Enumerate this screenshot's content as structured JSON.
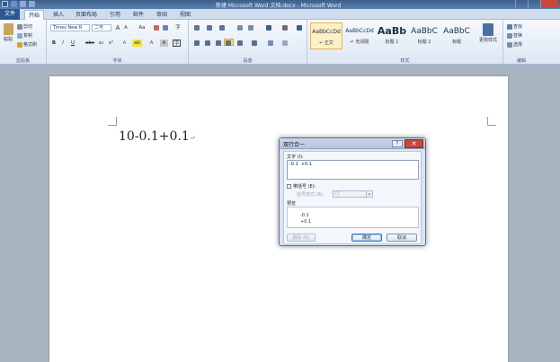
{
  "window": {
    "title": "新建 Microsoft Word 文档.docx - Microsoft Word"
  },
  "tabs": [
    {
      "label": "文件"
    },
    {
      "label": "开始"
    },
    {
      "label": "插入"
    },
    {
      "label": "页面布局"
    },
    {
      "label": "引用"
    },
    {
      "label": "邮件"
    },
    {
      "label": "审阅"
    },
    {
      "label": "视图"
    }
  ],
  "ribbon": {
    "clipboard": {
      "paste": "粘贴",
      "cut": "剪切",
      "copy": "复制",
      "format_painter": "格式刷",
      "group_label": "剪贴板"
    },
    "font": {
      "font_name": "Times New R",
      "font_size": "二号",
      "grow": "A",
      "shrink": "A",
      "change_case": "Aa",
      "bold": "B",
      "italic": "I",
      "underline": "U",
      "strikethrough": "abc",
      "subscript": "x₂",
      "superscript": "x²",
      "text_effects": "A",
      "highlight": "ab",
      "font_color": "A",
      "char_shading": "A",
      "enclose": "字",
      "group_label": "字体"
    },
    "paragraph": {
      "group_label": "段落"
    },
    "styles": {
      "items": [
        {
          "sample": "AaBbCcDd",
          "name": "↵ 正文"
        },
        {
          "sample": "AaBbCcDd",
          "name": "↵ 无间隔"
        },
        {
          "sample": "AaBb",
          "name": "标题 1"
        },
        {
          "sample": "AaBbC",
          "name": "标题 2"
        },
        {
          "sample": "AaBbC",
          "name": "标题"
        }
      ],
      "change_styles": "更改样式",
      "group_label": "样式"
    },
    "editing": {
      "find": "查找",
      "replace": "替换",
      "select": "选择",
      "group_label": "编辑"
    }
  },
  "document": {
    "equation_text": "10-0.1+0.1",
    "para_mark": "↵"
  },
  "dialog": {
    "title": "双行合一",
    "help": "?",
    "close": "✕",
    "text_label": "文字 (I):",
    "text_value": "-0.1  +0.1",
    "brackets_label": "带括号 (E):",
    "bracket_style_label": "括号样式 (B):",
    "bracket_style_value": "()",
    "preview_label": "预览",
    "preview_line1": "-0.1",
    "preview_line2": "+0.1",
    "delete_button": "删除 (R)",
    "ok_button": "确定",
    "cancel_button": "取消"
  }
}
